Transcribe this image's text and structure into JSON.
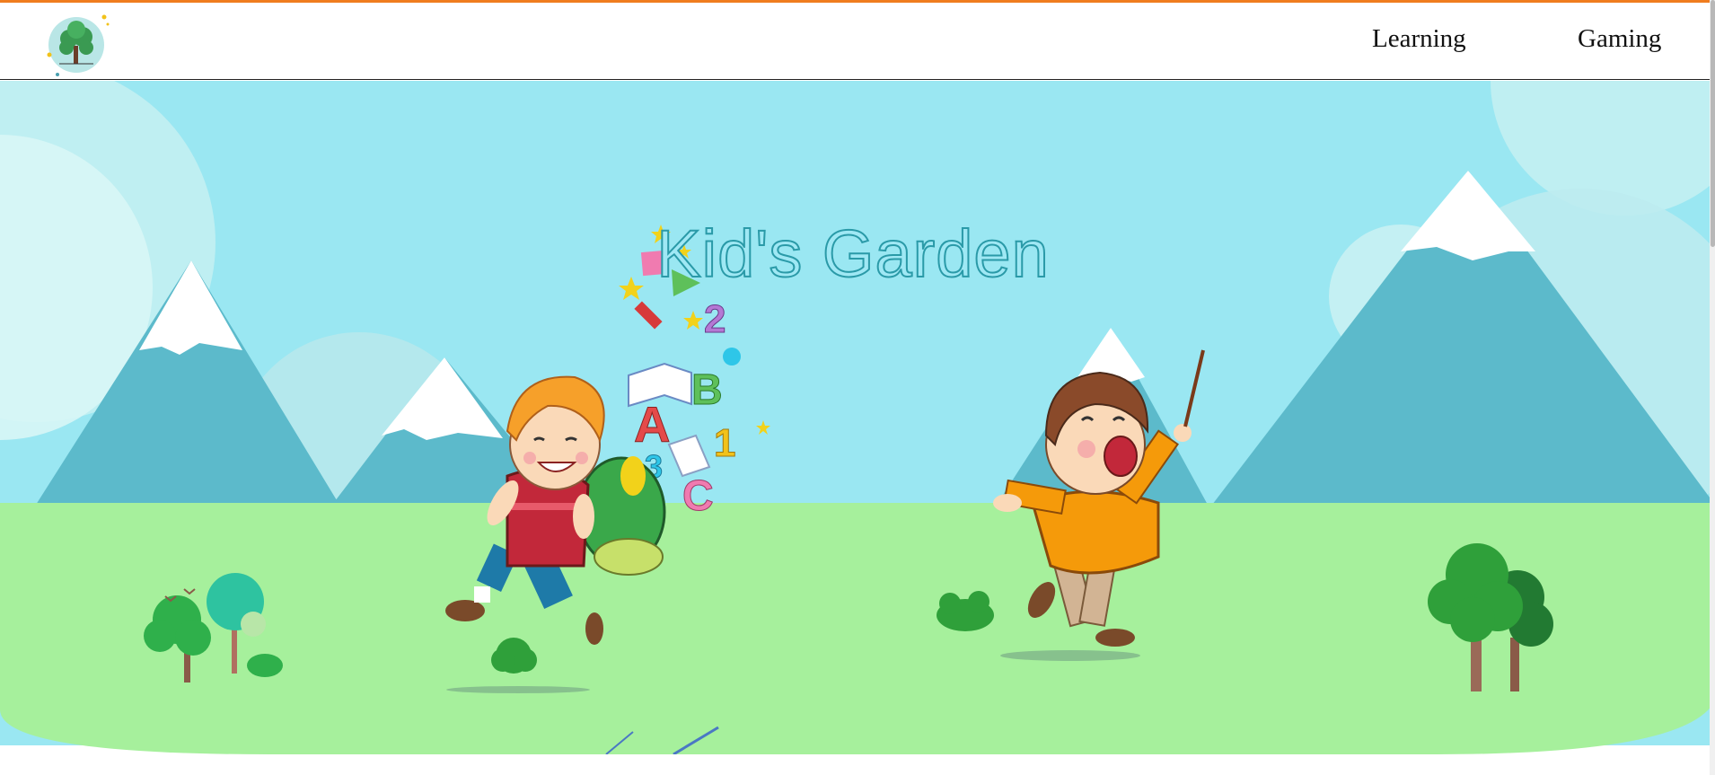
{
  "header": {
    "nav": [
      {
        "label": "Learning"
      },
      {
        "label": "Gaming"
      }
    ]
  },
  "hero": {
    "title": "Kid's Garden",
    "floating_characters": [
      "2",
      "A",
      "B",
      "1",
      "3",
      "C"
    ]
  },
  "colors": {
    "accent_top_border": "#f07d1f",
    "sky": "#9ae7f2",
    "mountain": "#60bccb",
    "grass": "#a6f09c",
    "title_fill": "#9fe8f4",
    "title_stroke": "#2a9aa8"
  }
}
